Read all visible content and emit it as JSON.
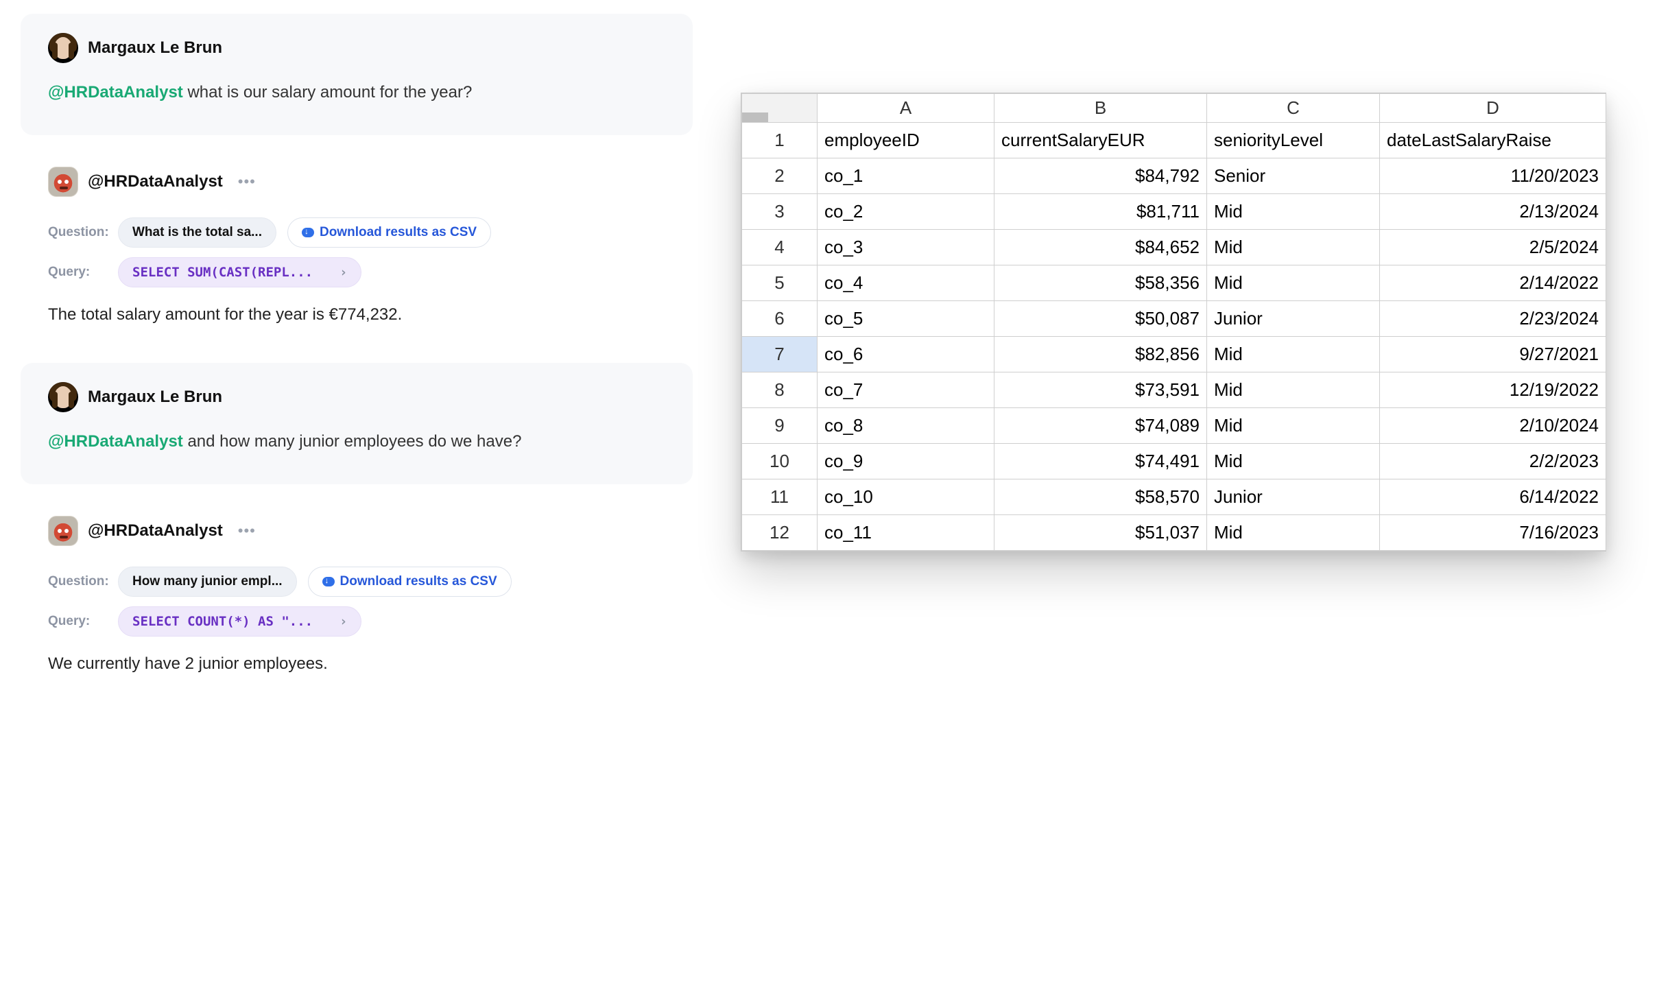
{
  "chat": {
    "messages": [
      {
        "author": "Margaux Le Brun",
        "mention": "@HRDataAnalyst",
        "text": "what is our salary amount for the year?"
      },
      {
        "author": "Margaux Le Brun",
        "mention": "@HRDataAnalyst",
        "text": "and how many junior employees do we have?"
      }
    ],
    "bot": {
      "name": "@HRDataAnalyst",
      "blocks": [
        {
          "question_label": "Question:",
          "question_pill": "What is the total sa...",
          "download_label": "Download results as CSV",
          "query_label": "Query:",
          "query_pill": "SELECT SUM(CAST(REPL...",
          "response": "The total salary amount for the year is €774,232."
        },
        {
          "question_label": "Question:",
          "question_pill": "How many junior empl...",
          "download_label": "Download results as CSV",
          "query_label": "Query:",
          "query_pill": "SELECT COUNT(*) AS \"...",
          "response": "We currently have 2 junior employees."
        }
      ]
    }
  },
  "glyphs": {
    "chevron_right": "›",
    "more": "•••"
  },
  "sheet": {
    "columns": [
      "A",
      "B",
      "C",
      "D"
    ],
    "headers": [
      "employeeID",
      "currentSalaryEUR",
      "seniorityLevel",
      "dateLastSalaryRaise"
    ],
    "selected_row": 7,
    "rows": [
      {
        "n": 1,
        "A": "employeeID",
        "B": "currentSalaryEUR",
        "C": "seniorityLevel",
        "D": "dateLastSalaryRaise"
      },
      {
        "n": 2,
        "A": "co_1",
        "B": "$84,792",
        "C": "Senior",
        "D": "11/20/2023"
      },
      {
        "n": 3,
        "A": "co_2",
        "B": "$81,711",
        "C": "Mid",
        "D": "2/13/2024"
      },
      {
        "n": 4,
        "A": "co_3",
        "B": "$84,652",
        "C": "Mid",
        "D": "2/5/2024"
      },
      {
        "n": 5,
        "A": "co_4",
        "B": "$58,356",
        "C": "Mid",
        "D": "2/14/2022"
      },
      {
        "n": 6,
        "A": "co_5",
        "B": "$50,087",
        "C": "Junior",
        "D": "2/23/2024"
      },
      {
        "n": 7,
        "A": "co_6",
        "B": "$82,856",
        "C": "Mid",
        "D": "9/27/2021"
      },
      {
        "n": 8,
        "A": "co_7",
        "B": "$73,591",
        "C": "Mid",
        "D": "12/19/2022"
      },
      {
        "n": 9,
        "A": "co_8",
        "B": "$74,089",
        "C": "Mid",
        "D": "2/10/2024"
      },
      {
        "n": 10,
        "A": "co_9",
        "B": "$74,491",
        "C": "Mid",
        "D": "2/2/2023"
      },
      {
        "n": 11,
        "A": "co_10",
        "B": "$58,570",
        "C": "Junior",
        "D": "6/14/2022"
      },
      {
        "n": 12,
        "A": "co_11",
        "B": "$51,037",
        "C": "Mid",
        "D": "7/16/2023"
      }
    ]
  }
}
